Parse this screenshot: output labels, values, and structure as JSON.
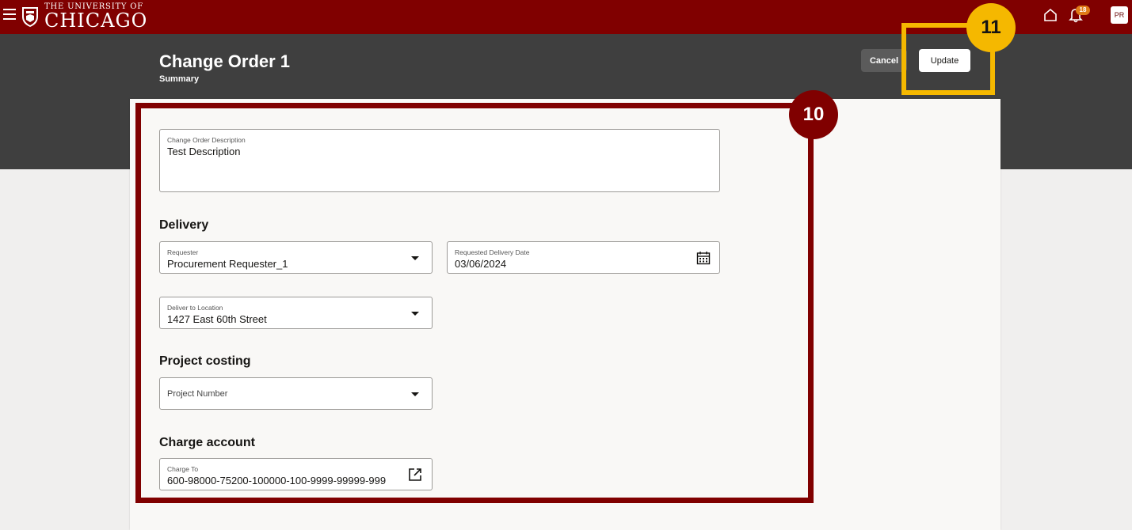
{
  "topbar": {
    "logo_line1": "THE UNIVERSITY OF",
    "logo_line2": "CHICAGO",
    "notification_count": "18",
    "avatar_initials": "PR",
    "brand_color": "#800000"
  },
  "header": {
    "title": "Change Order 1",
    "subtitle": "Summary",
    "cancel_label": "Cancel",
    "update_label": "Update"
  },
  "form": {
    "description": {
      "label": "Change Order Description",
      "value": "Test Description"
    },
    "delivery": {
      "heading": "Delivery",
      "requester": {
        "label": "Requester",
        "value": "Procurement Requester_1"
      },
      "delivery_date": {
        "label": "Requested Delivery Date",
        "value": "03/06/2024"
      },
      "location": {
        "label": "Deliver to Location",
        "value": "1427 East 60th Street"
      }
    },
    "project_costing": {
      "heading": "Project costing",
      "project_number": {
        "placeholder": "Project Number"
      }
    },
    "charge_account": {
      "heading": "Charge account",
      "charge_to": {
        "label": "Charge To",
        "value": "600-98000-75200-100000-100-9999-99999-999"
      }
    }
  },
  "annotations": {
    "step10": "10",
    "step11": "11",
    "step10_color": "#800000",
    "step11_color": "#f5b800"
  },
  "icons": [
    "menu-icon",
    "university-shield-icon",
    "home-icon",
    "bell-icon",
    "calendar-icon",
    "chevron-down-icon",
    "external-link-icon"
  ]
}
